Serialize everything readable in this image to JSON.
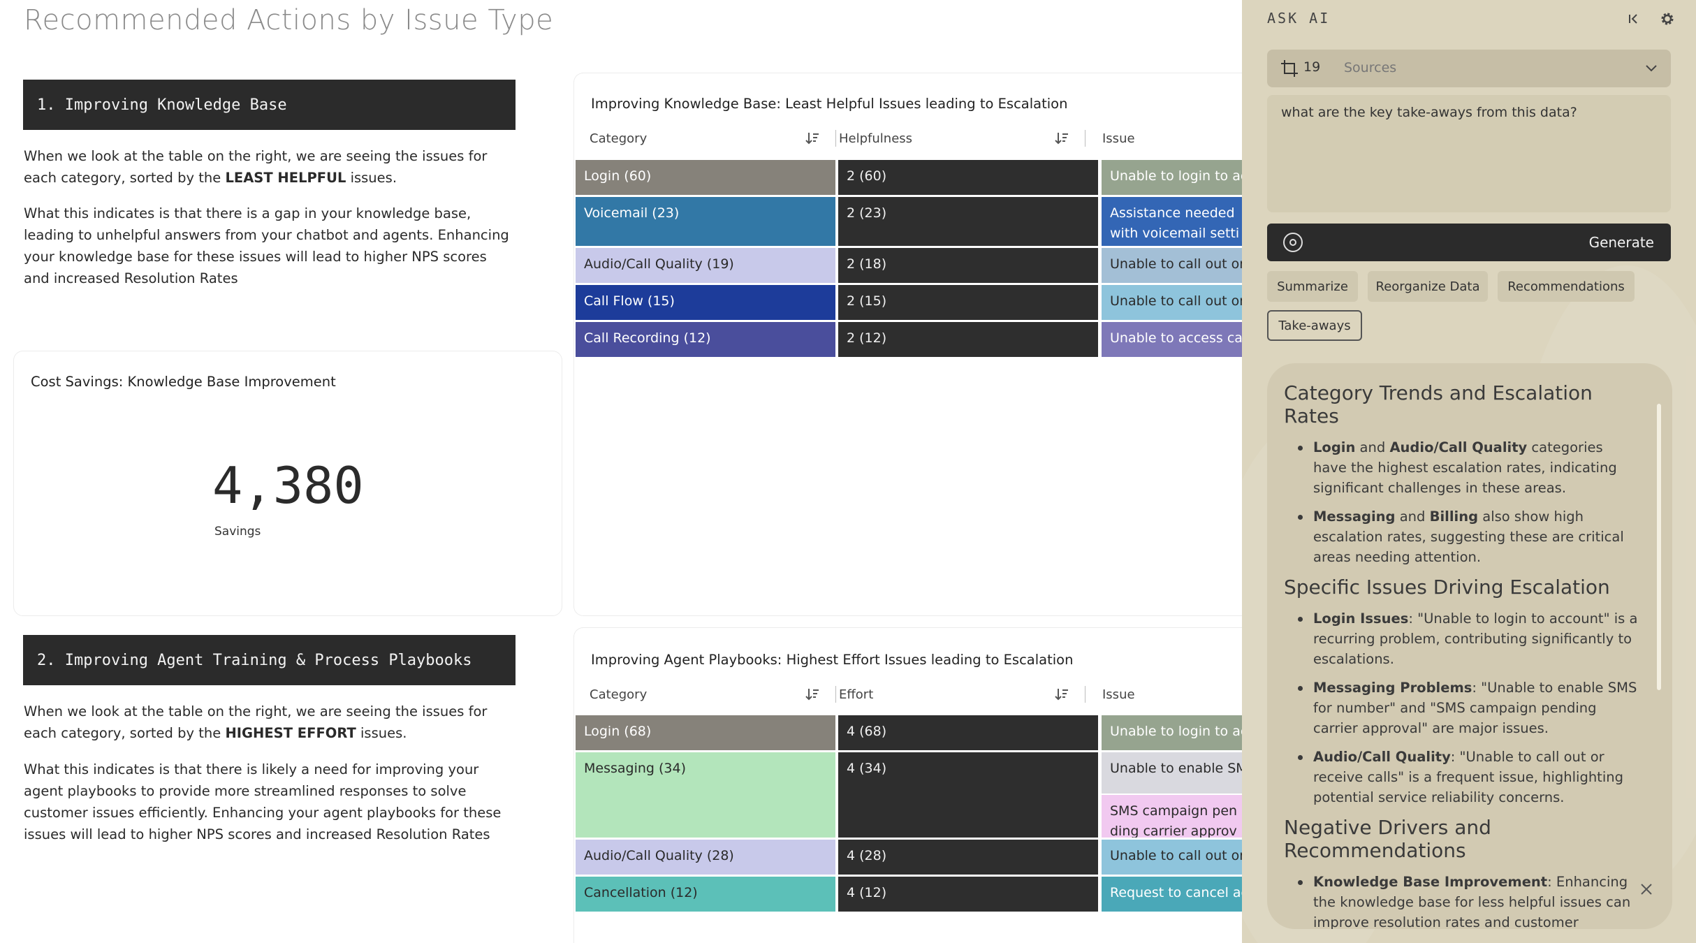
{
  "page": {
    "title": "Recommended Actions by Issue Type"
  },
  "section1": {
    "header": "1. Improving Knowledge Base",
    "p1_a": "When we look at the table on the right, we are seeing the issues for each category, sorted by the ",
    "p1_b": "LEAST HELPFUL",
    "p1_c": " issues.",
    "p2": "What this indicates is that there is a gap in your knowledge base, leading to unhelpful answers from your chatbot and agents. Enhancing your knowledge base for these issues will lead to higher NPS scores and increased Resolution Rates"
  },
  "savings_card": {
    "title": "Cost Savings: Knowledge Base Improvement",
    "value": "4,380",
    "caption": "Savings"
  },
  "section2": {
    "header": "2. Improving Agent Training & Process Playbooks",
    "p1_a": "When we look at the table on the right, we are seeing the issues for each category, sorted by the ",
    "p1_b": "HIGHEST EFFORT",
    "p1_c": " issues.",
    "p2": "What this indicates is that there is likely a need for improving your agent playbooks to provide more streamlined responses to solve customer issues efficiently. Enhancing your agent playbooks for these issues will lead to higher NPS scores and increased Resolution Rates"
  },
  "table1": {
    "title": "Improving Knowledge Base: Least Helpful Issues leading to Escalation",
    "columns": [
      "Category",
      "Helpfulness",
      "Issue"
    ],
    "rows": [
      {
        "category": "Login (60)",
        "metric": "2 (60)",
        "issue": "Unable to login to account",
        "color": "#86827a"
      },
      {
        "category": "Voicemail (23)",
        "metric": "2 (23)",
        "issue": "Assistance needed with voicemail settings",
        "color": "#3278a6"
      },
      {
        "category": "Audio/Call Quality (19)",
        "metric": "2 (18)",
        "issue": "Unable to call out or receive calls",
        "color": "#c8c9ea"
      },
      {
        "category": "Call Flow (15)",
        "metric": "2 (15)",
        "issue": "Unable to call out or receive calls",
        "color": "#1d3c9a"
      },
      {
        "category": "Call Recording (12)",
        "metric": "2 (12)",
        "issue": "Unable to access call recordings",
        "color": "#4a4e9c"
      }
    ],
    "issue_colors": [
      "#96a48f",
      "#3366b5",
      "#a3bfd6",
      "#8ec4dc",
      "#7e78b8"
    ]
  },
  "table2": {
    "title": "Improving Agent Playbooks: Highest Effort Issues leading to Escalation",
    "columns": [
      "Category",
      "Effort",
      "Issue"
    ],
    "rows": [
      {
        "category": "Login (68)",
        "metric": "4 (68)",
        "issue": "Unable to login to account",
        "color": "#86827a"
      },
      {
        "category": "Messaging (34)",
        "metric": "4 (34)",
        "issue": "Unable to enable SMS for number",
        "issue2": "SMS campaign pending carrier approval",
        "color": "#b3e5bb"
      },
      {
        "category": "Audio/Call Quality (28)",
        "metric": "4 (28)",
        "issue": "Unable to call out or receive calls",
        "color": "#c8c9ea"
      },
      {
        "category": "Cancellation (12)",
        "metric": "4 (12)",
        "issue": "Request to cancel account",
        "color": "#5cc0b8"
      }
    ],
    "issue_colors": [
      "#96a48f",
      "#d9d9df",
      "#f1c9f0",
      "#8ec4dc",
      "#4aa8b8"
    ]
  },
  "ai": {
    "title": "ASK AI",
    "sources_count": "19",
    "sources_label": "Sources",
    "prompt": "what are the key take-aways from this data?",
    "generate_label": "Generate",
    "chips": [
      "Summarize",
      "Reorganize Data",
      "Recommendations",
      "Take-aways"
    ],
    "result": {
      "h1": "Category Trends and Escalation Rates",
      "b1_bold1": "Login",
      "b1_mid": " and ",
      "b1_bold2": "Audio/Call Quality",
      "b1_rest": " categories have the highest escalation rates, indicating significant challenges in these areas.",
      "b2_bold1": "Messaging",
      "b2_mid": " and ",
      "b2_bold2": "Billing",
      "b2_rest": " also show high escalation rates, suggesting these are critical areas needing attention.",
      "h2": "Specific Issues Driving Escalation",
      "b3_bold": "Login Issues",
      "b3_rest": ": \"Unable to login to account\" is a recurring problem, contributing significantly to escalations.",
      "b4_bold": "Messaging Problems",
      "b4_rest": ": \"Unable to enable SMS for number\" and \"SMS campaign pending carrier approval\" are major issues.",
      "b5_bold": "Audio/Call Quality",
      "b5_rest": ": \"Unable to call out or receive calls\" is a frequent issue, highlighting potential service reliability concerns.",
      "h3": "Negative Drivers and Recommendations",
      "b6_bold": "Knowledge Base Improvement",
      "b6_rest": ": Enhancing the knowledge base for less helpful issues can improve resolution rates and customer satisfaction."
    }
  }
}
